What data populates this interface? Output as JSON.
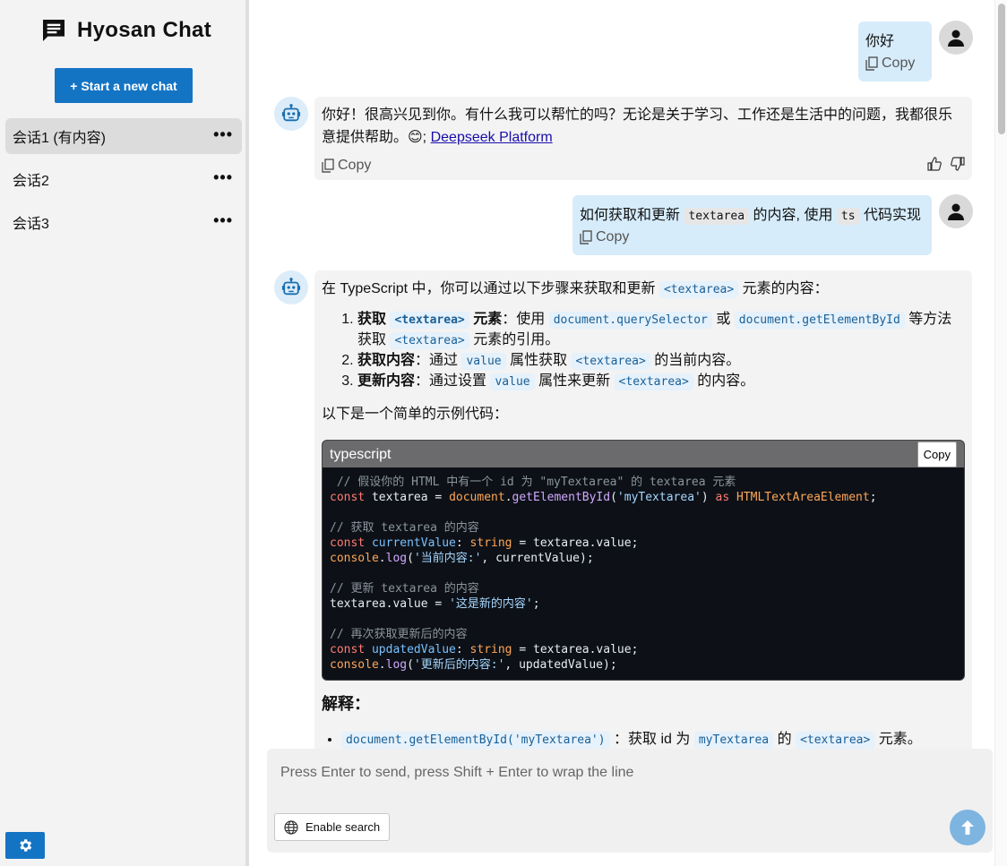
{
  "app": {
    "title": "Hyosan Chat",
    "new_chat_label": "+ Start a new chat"
  },
  "sidebar": {
    "conversations": [
      {
        "label": "会话1 (有内容)",
        "more": "•••",
        "active": true
      },
      {
        "label": "会话2",
        "more": "•••"
      },
      {
        "label": "会话3",
        "more": "•••"
      }
    ]
  },
  "messages": {
    "m1": {
      "text": "你好",
      "copy": "Copy"
    },
    "m2": {
      "text": "你好！很高兴见到你。有什么我可以帮忙的吗？无论是关于学习、工作还是生活中的问题，我都很乐意提供帮助。😊;",
      "link": "Deepseek Platform",
      "copy": "Copy"
    },
    "m3": {
      "t1": "如何获取和更新",
      "code1": "textarea",
      "t2": "的内容, 使用",
      "code2": "ts",
      "t3": "代码实现",
      "copy": "Copy"
    },
    "m4": {
      "intro_a": "在 TypeScript 中，你可以通过以下步骤来获取和更新",
      "intro_code": "<textarea>",
      "intro_b": "元素的内容：",
      "step1_bold": "获取",
      "step1_code": "<textarea>",
      "step1_bold2": "元素",
      "step1_t1": "：使用",
      "step1_code2": "document.querySelector",
      "step1_t2": "或",
      "step1_code3": "document.getElementById",
      "step1_t3": "等方法获取",
      "step1_code4": "<textarea>",
      "step1_t4": "元素的引用。",
      "step2_bold": "获取内容",
      "step2_t1": "：通过",
      "step2_code": "value",
      "step2_t2": "属性获取",
      "step2_code2": "<textarea>",
      "step2_t3": "的当前内容。",
      "step3_bold": "更新内容",
      "step3_t1": "：通过设置",
      "step3_code": "value",
      "step3_t2": "属性来更新",
      "step3_code2": "<textarea>",
      "step3_t3": "的内容。",
      "below": "以下是一个简单的示例代码：",
      "code_lang": "typescript",
      "code_copy": "Copy",
      "explain": "解释：",
      "bullet_code": "document.getElementById('myTextarea')",
      "bullet_t1": "：获取 id 为",
      "bullet_code2": "myTextarea",
      "bullet_t2": "的",
      "bullet_code3": "<textarea>",
      "bullet_t3": "元素。"
    }
  },
  "composer": {
    "placeholder": "Press Enter to send, press Shift + Enter to wrap the line",
    "search_label": "Enable search"
  },
  "colors": {
    "accent": "#1474c4",
    "user_bubble": "#d6ecfb",
    "bot_bubble": "#f3f3f3"
  }
}
